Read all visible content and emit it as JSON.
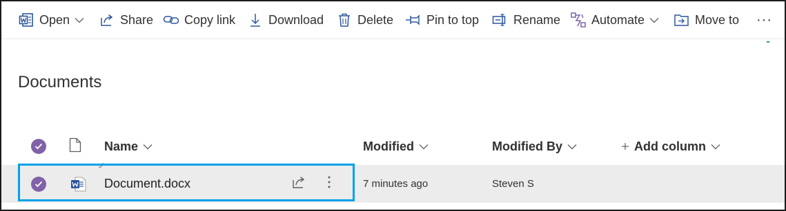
{
  "toolbar": {
    "open": "Open",
    "share": "Share",
    "copy_link": "Copy link",
    "download": "Download",
    "delete": "Delete",
    "pin_to_top": "Pin to top",
    "rename": "Rename",
    "automate": "Automate",
    "move_to": "Move to",
    "more": "···"
  },
  "library": {
    "title": "Documents"
  },
  "columns": {
    "name": "Name",
    "modified": "Modified",
    "modified_by": "Modified By",
    "add_column": "Add column"
  },
  "rows": [
    {
      "name": "Document.docx",
      "modified": "7 minutes ago",
      "modified_by": "Steven S",
      "selected": true
    }
  ],
  "colors": {
    "accent_purple": "#7f62a8",
    "word_blue": "#2b579a",
    "selected_row_bg": "#ececec",
    "highlight_border": "#00a2e8"
  },
  "icons": {
    "open": "word-app-icon",
    "share": "share-icon",
    "copy_link": "link-icon",
    "download": "download-icon",
    "delete": "trash-icon",
    "pin": "pin-icon",
    "rename": "rename-icon",
    "automate": "flow-icon",
    "move": "move-to-icon",
    "file_type": "word-document-icon"
  }
}
